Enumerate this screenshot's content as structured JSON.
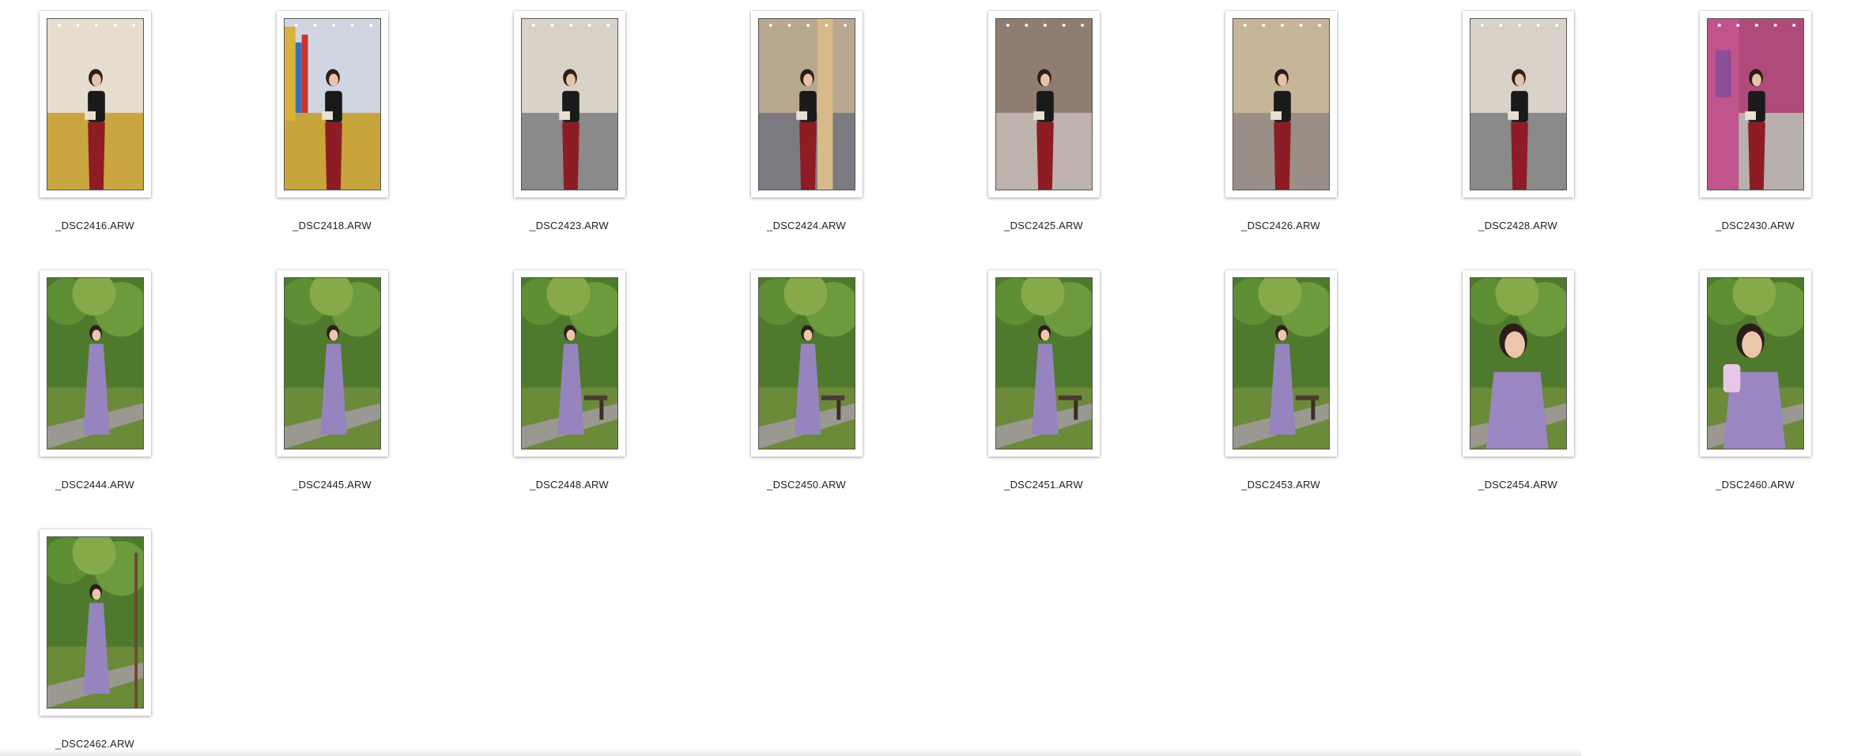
{
  "files": [
    {
      "name": "_DSC2416.ARW",
      "scene": "mall-yellow"
    },
    {
      "name": "_DSC2418.ARW",
      "scene": "mall-colorful"
    },
    {
      "name": "_DSC2423.ARW",
      "scene": "mall-gray"
    },
    {
      "name": "_DSC2424.ARW",
      "scene": "mall-pillar"
    },
    {
      "name": "_DSC2425.ARW",
      "scene": "mall-rail"
    },
    {
      "name": "_DSC2426.ARW",
      "scene": "mall-shop"
    },
    {
      "name": "_DSC2428.ARW",
      "scene": "mall-corridor"
    },
    {
      "name": "_DSC2430.ARW",
      "scene": "mall-mural"
    },
    {
      "name": "_DSC2444.ARW",
      "scene": "park-path"
    },
    {
      "name": "_DSC2445.ARW",
      "scene": "park-trees"
    },
    {
      "name": "_DSC2448.ARW",
      "scene": "park-bench"
    },
    {
      "name": "_DSC2450.ARW",
      "scene": "park-bench"
    },
    {
      "name": "_DSC2451.ARW",
      "scene": "park-bench"
    },
    {
      "name": "_DSC2453.ARW",
      "scene": "park-bench-tilt"
    },
    {
      "name": "_DSC2454.ARW",
      "scene": "park-closeup"
    },
    {
      "name": "_DSC2460.ARW",
      "scene": "park-selfie"
    },
    {
      "name": "_DSC2462.ARW",
      "scene": "park-lamp"
    }
  ],
  "colors": {
    "background": "#ffffff",
    "label_text": "#1f1f1f"
  }
}
